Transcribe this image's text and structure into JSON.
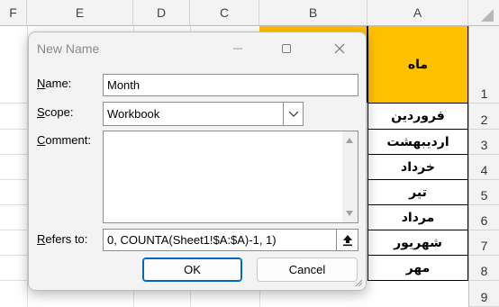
{
  "sheet": {
    "columns": [
      "F",
      "E",
      "D",
      "C",
      "B",
      "A"
    ],
    "rows": [
      "1",
      "2",
      "3",
      "4",
      "5",
      "6",
      "7",
      "8",
      "9"
    ],
    "column_a": [
      "ماه",
      "فروردین",
      "اردیبهشت",
      "خرداد",
      "تیر",
      "مرداد",
      "شهریور",
      "مهر"
    ],
    "header_fill": "#ffc000"
  },
  "dialog": {
    "title": "New Name",
    "name_label": "Name:",
    "name_value": "Month",
    "scope_label": "Scope:",
    "scope_value": "Workbook",
    "comment_label": "Comment:",
    "comment_value": "",
    "refers_label": "Refers to:",
    "refers_value": "0, COUNTA(Sheet1!$A:$A)-1, 1)",
    "ok_label": "OK",
    "cancel_label": "Cancel",
    "accent": "#0067c0"
  },
  "icons": [
    "minimize-icon",
    "maximize-icon",
    "close-icon",
    "chevron-down-icon",
    "collapse-dialog-icon",
    "resize-grip-icon"
  ]
}
